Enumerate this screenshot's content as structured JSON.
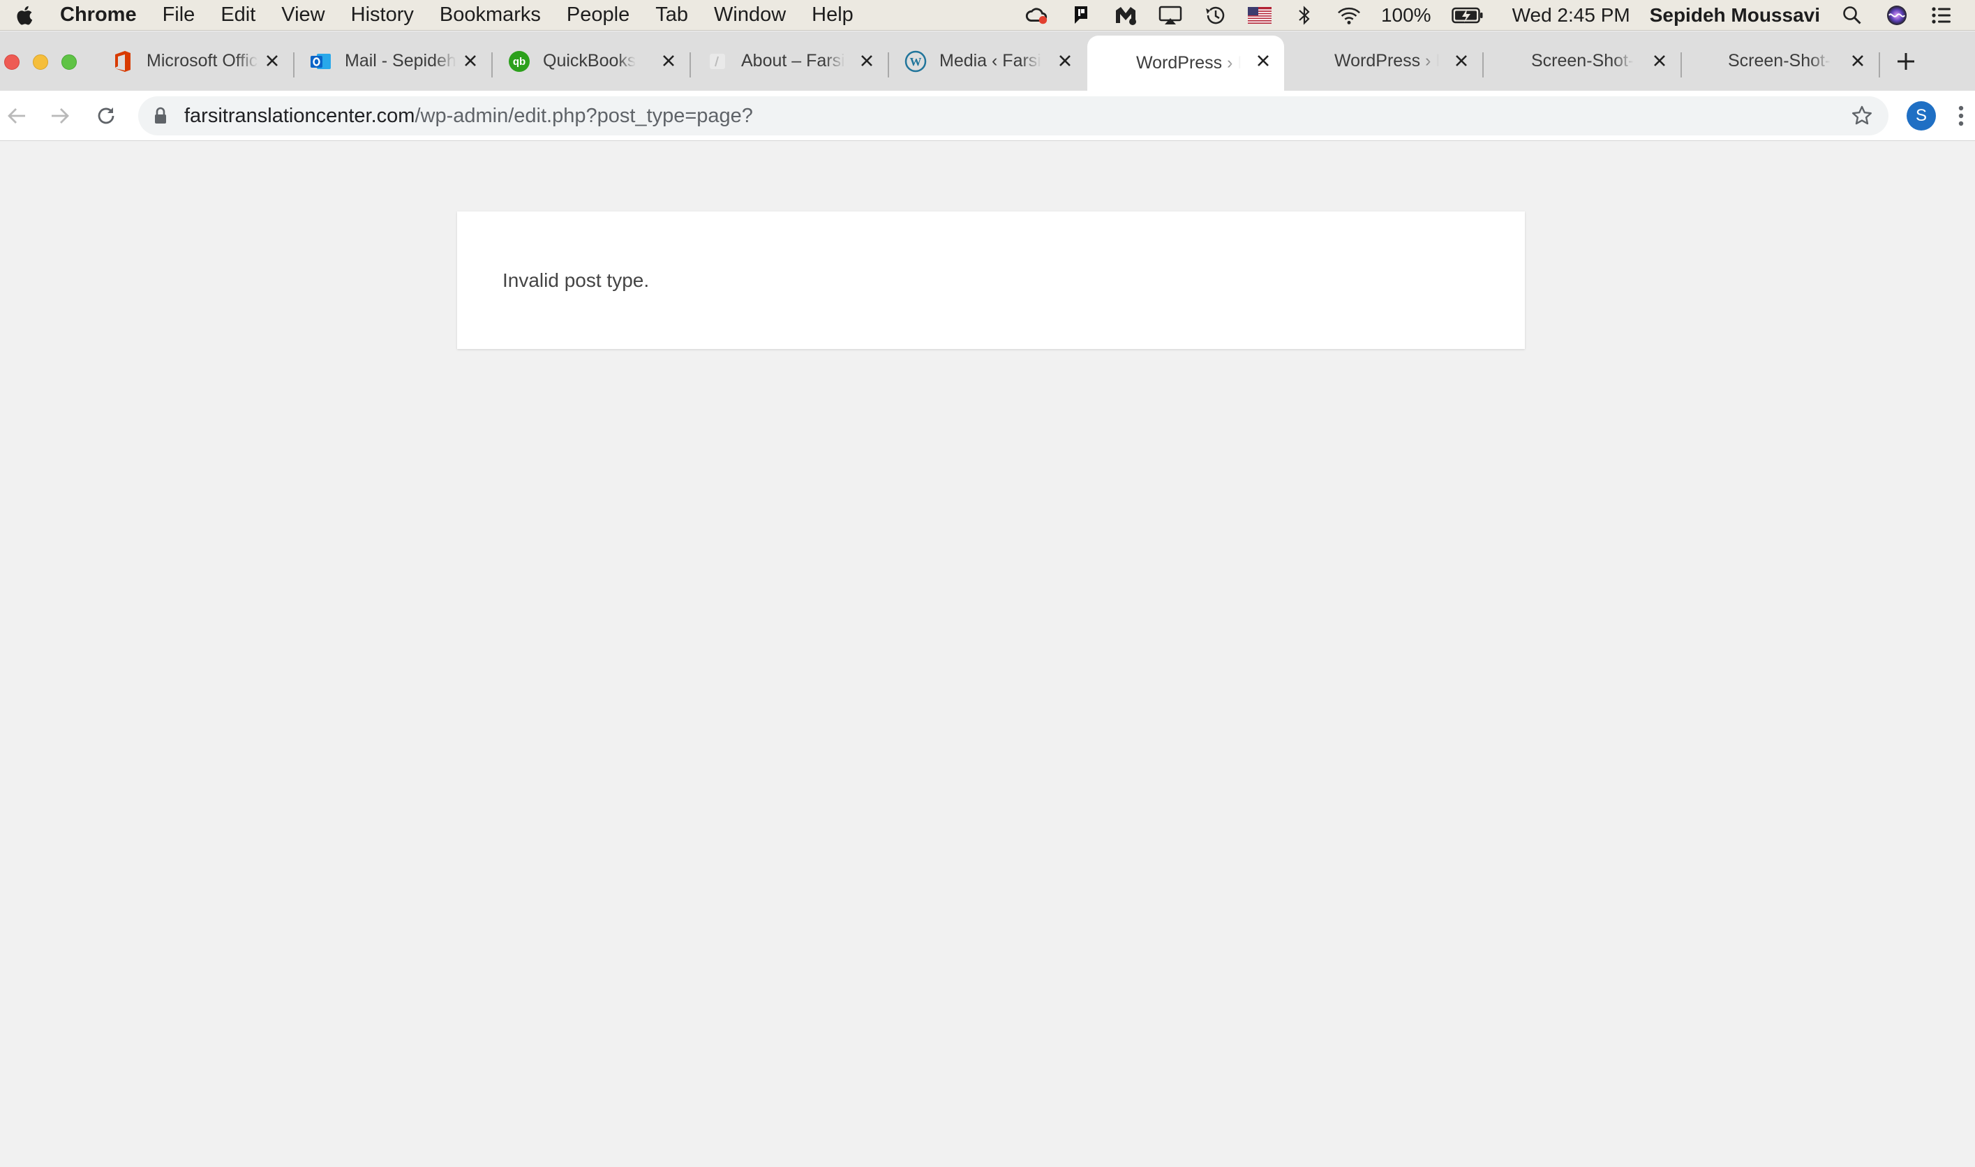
{
  "menubar": {
    "app": "Chrome",
    "items": [
      "File",
      "Edit",
      "View",
      "History",
      "Bookmarks",
      "People",
      "Tab",
      "Window",
      "Help"
    ],
    "battery": "100%",
    "clock": "Wed 2:45 PM",
    "user": "Sepideh Moussavi",
    "icons": [
      "creative-cloud-icon",
      "pushbullet-icon",
      "malwarebytes-icon",
      "airplay-icon",
      "time-machine-icon",
      "us-flag-icon",
      "bluetooth-icon",
      "wifi-icon",
      "battery-icon",
      "spotlight-icon",
      "siri-icon",
      "control-center-icon"
    ]
  },
  "tabs": [
    {
      "title": "Microsoft Office",
      "favicon": "office-icon",
      "color": "#d83b01"
    },
    {
      "title": "Mail - Sepideh",
      "favicon": "outlook-icon",
      "color": "#0a64c8"
    },
    {
      "title": "QuickBooks",
      "favicon": "quickbooks-icon",
      "color": "#2ca01c"
    },
    {
      "title": "About – Farsi",
      "favicon": "site-icon",
      "color": "#cccccc"
    },
    {
      "title": "Media ‹ Farsi",
      "favicon": "wordpress-icon",
      "color": "#21759b"
    },
    {
      "title": "WordPress › E",
      "favicon": "",
      "color": ""
    },
    {
      "title": "WordPress › E",
      "favicon": "",
      "color": ""
    },
    {
      "title": "Screen-Shot-",
      "favicon": "",
      "color": ""
    },
    {
      "title": "Screen-Shot-",
      "favicon": "",
      "color": ""
    }
  ],
  "active_tab_index": 5,
  "toolbar": {
    "url_domain": "farsitranslationcenter.com",
    "url_path": "/wp-admin/edit.php?post_type=page?",
    "profile_initial": "S",
    "profile_color": "#1f6fc4"
  },
  "page": {
    "error_message": "Invalid post type."
  }
}
